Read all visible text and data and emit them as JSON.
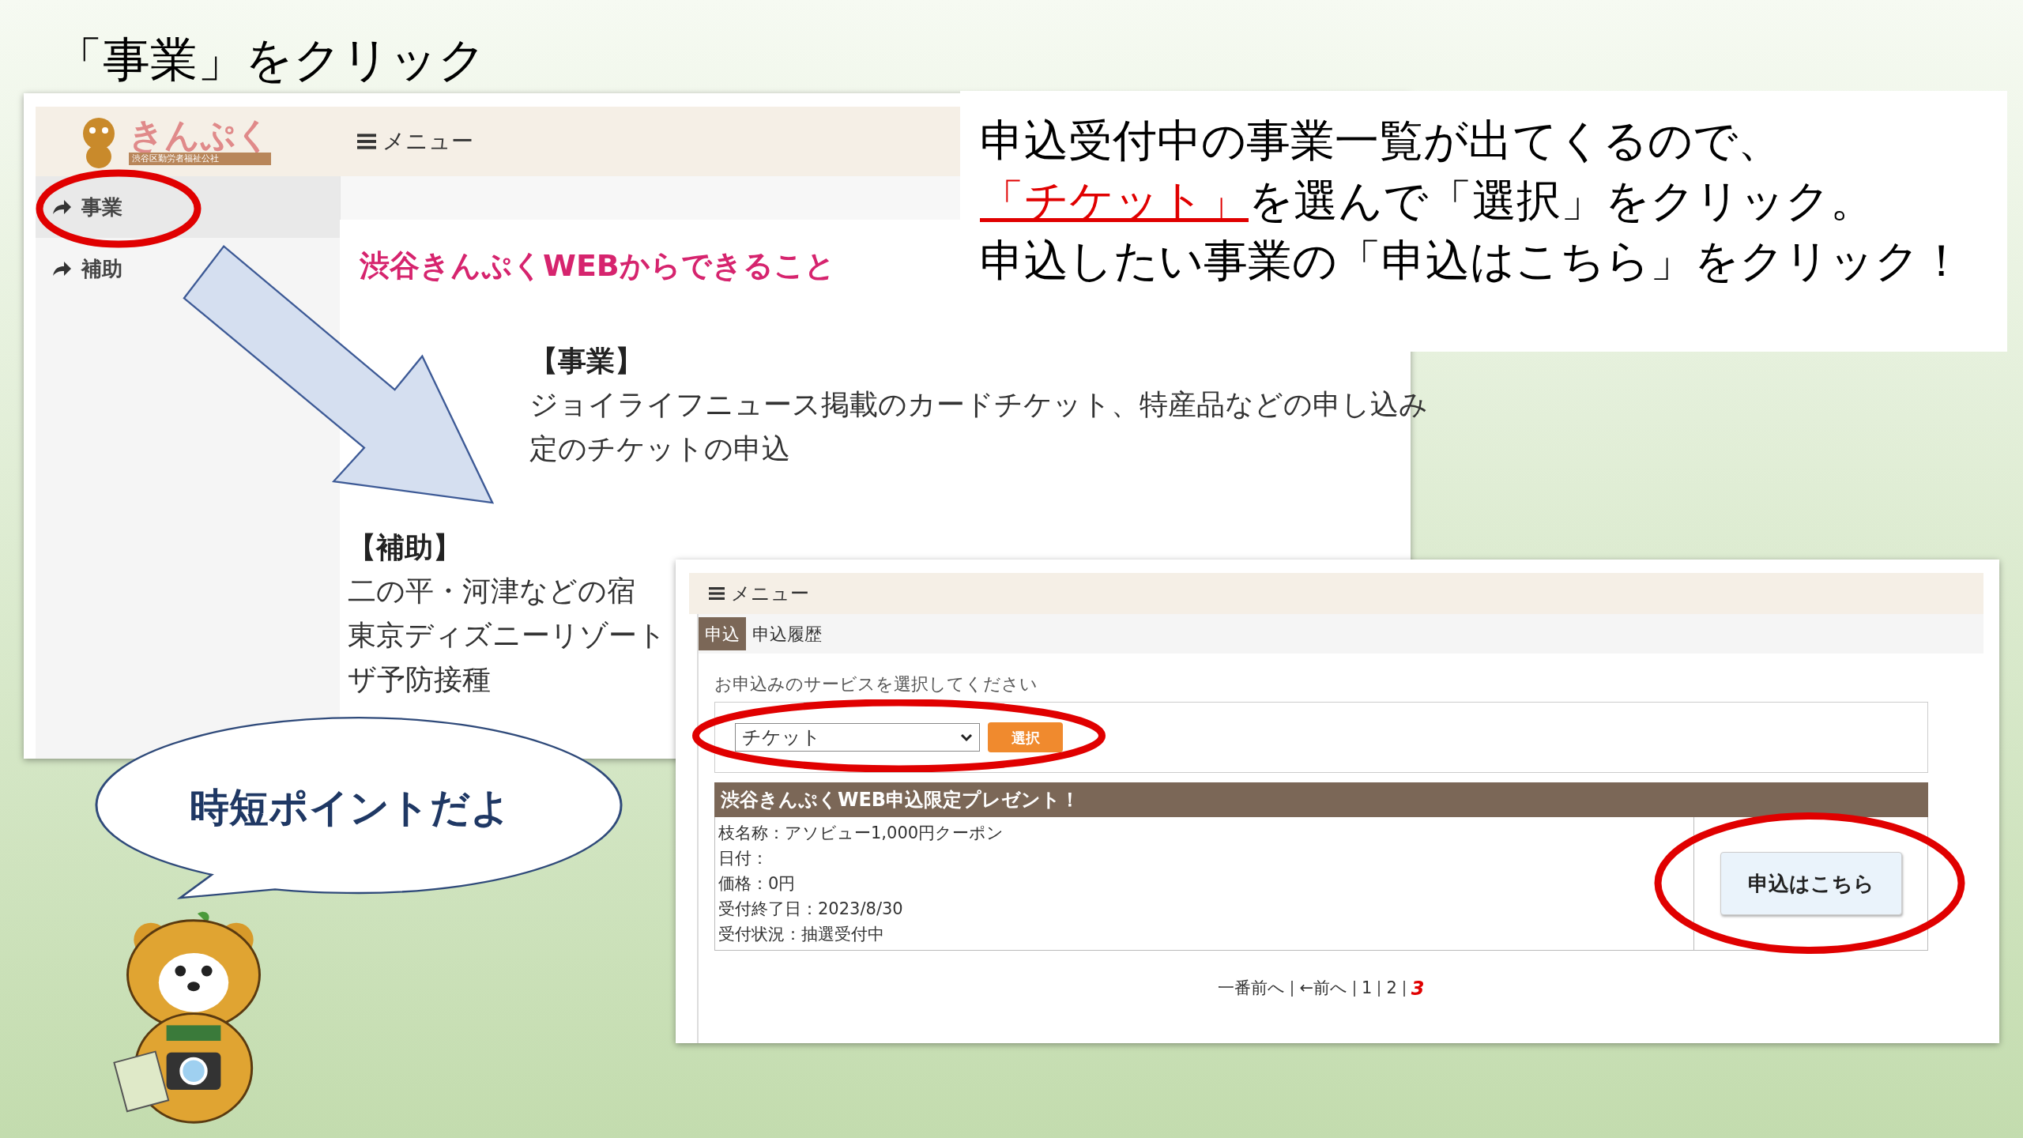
{
  "slide_title": "「事業」をクリック",
  "instruction": {
    "line1": "申込受付中の事業一覧が出てくるので、",
    "line2_highlight": "「チケット」",
    "line2_rest": "を選んで「選択」をクリック。",
    "line3": "申込したい事業の「申込はこちら」をクリック！"
  },
  "window1": {
    "logo": "きんぷく",
    "logo_sub": "渋谷区勤労者福祉公社",
    "menu": "メニュー",
    "sidebar": [
      {
        "label": "事業",
        "selected": true
      },
      {
        "label": "補助",
        "selected": false
      }
    ],
    "heading": "渋谷きんぷくWEBからできること",
    "sections": [
      {
        "title": "【事業】",
        "lines": [
          "ジョイライフニュース掲載のカードチケット、特産品などの申し込み",
          "定のチケットの申込"
        ]
      },
      {
        "title": "【補助】",
        "lines": [
          "二の平・河津などの宿",
          "東京ディズニーリゾート",
          "ザ予防接種"
        ]
      }
    ]
  },
  "callout": "時短ポイントだよ",
  "window2": {
    "menu": "メニュー",
    "tabs": [
      {
        "label": "申込",
        "selected": true
      },
      {
        "label": "申込履歴",
        "selected": false
      }
    ],
    "prompt": "お申込みのサービスを選択してください",
    "select": "チケット",
    "select_button": "選択",
    "item": {
      "title": "渋谷きんぷくWEB申込限定プレゼント！",
      "details": [
        "枝名称：アソビュー1,000円クーポン",
        "日付：",
        "価格：0円",
        "受付終了日：2023/8/30",
        "受付状況：抽選受付中"
      ],
      "button": "申込はこちら"
    },
    "pagination": [
      {
        "label": "一番前へ",
        "selected": false
      },
      {
        "label": "←前へ",
        "selected": false
      },
      {
        "label": "1",
        "selected": false
      },
      {
        "label": "2",
        "selected": false
      },
      {
        "label": "3",
        "selected": true
      }
    ]
  }
}
